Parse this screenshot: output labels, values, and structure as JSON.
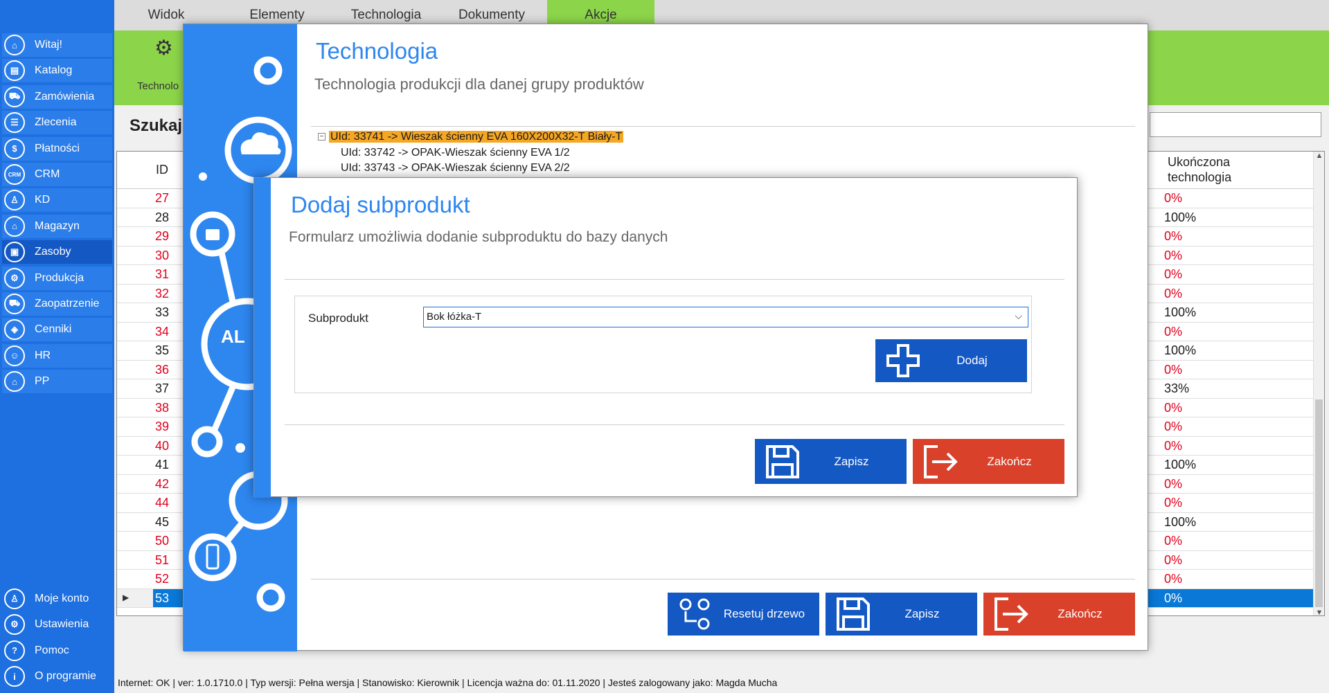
{
  "sidebar": {
    "items": [
      {
        "label": "Witaj!",
        "icon": "home-icon",
        "glyph": "⌂"
      },
      {
        "label": "Katalog",
        "icon": "book-icon",
        "glyph": "▤"
      },
      {
        "label": "Zamówienia",
        "icon": "cart-icon",
        "glyph": "⛟"
      },
      {
        "label": "Zlecenia",
        "icon": "list-icon",
        "glyph": "☰"
      },
      {
        "label": "Płatności",
        "icon": "dollar-icon",
        "glyph": "$"
      },
      {
        "label": "CRM",
        "icon": "crm-icon",
        "glyph": "CRM"
      },
      {
        "label": "KD",
        "icon": "user-icon",
        "glyph": "♙"
      },
      {
        "label": "Magazyn",
        "icon": "warehouse-icon",
        "glyph": "⌂"
      },
      {
        "label": "Zasoby",
        "icon": "box-icon",
        "glyph": "▣"
      },
      {
        "label": "Produkcja",
        "icon": "production-icon",
        "glyph": "⚙"
      },
      {
        "label": "Zaopatrzenie",
        "icon": "truck-icon",
        "glyph": "⛟"
      },
      {
        "label": "Cenniki",
        "icon": "tag-icon",
        "glyph": "◈"
      },
      {
        "label": "HR",
        "icon": "hr-icon",
        "glyph": "☺"
      },
      {
        "label": "PP",
        "icon": "factory-icon",
        "glyph": "⌂"
      }
    ],
    "bottom_items": [
      {
        "label": "Moje konto",
        "icon": "account-icon",
        "glyph": "♙"
      },
      {
        "label": "Ustawienia",
        "icon": "settings-icon",
        "glyph": "⚙"
      },
      {
        "label": "Pomoc",
        "icon": "help-icon",
        "glyph": "?"
      },
      {
        "label": "O programie",
        "icon": "info-icon",
        "glyph": "i"
      }
    ],
    "active_item": "Zasoby"
  },
  "topmenu": {
    "tabs": [
      "Widok",
      "Elementy",
      "Technologia",
      "Dokumenty",
      "Akcje"
    ],
    "active_tab": "Akcje"
  },
  "ribbon": {
    "label": "Technolo"
  },
  "search": {
    "label": "Szukaj:"
  },
  "grid": {
    "id_header": "ID",
    "tech_header_line1": "Ukończona",
    "tech_header_line2": "technologia",
    "rows": [
      {
        "id": "27",
        "pct": "0%",
        "red": true
      },
      {
        "id": "28",
        "pct": "100%",
        "red": false
      },
      {
        "id": "29",
        "pct": "0%",
        "red": true
      },
      {
        "id": "30",
        "pct": "0%",
        "red": true
      },
      {
        "id": "31",
        "pct": "0%",
        "red": true
      },
      {
        "id": "32",
        "pct": "0%",
        "red": true
      },
      {
        "id": "33",
        "pct": "100%",
        "red": false
      },
      {
        "id": "34",
        "pct": "0%",
        "red": true
      },
      {
        "id": "35",
        "pct": "100%",
        "red": false
      },
      {
        "id": "36",
        "pct": "0%",
        "red": true
      },
      {
        "id": "37",
        "pct": "33%",
        "red": false
      },
      {
        "id": "38",
        "pct": "0%",
        "red": true
      },
      {
        "id": "39",
        "pct": "0%",
        "red": true
      },
      {
        "id": "40",
        "pct": "0%",
        "red": true
      },
      {
        "id": "41",
        "pct": "100%",
        "red": false
      },
      {
        "id": "42",
        "pct": "0%",
        "red": true
      },
      {
        "id": "44",
        "pct": "0%",
        "red": true
      },
      {
        "id": "45",
        "pct": "100%",
        "red": false
      },
      {
        "id": "50",
        "pct": "0%",
        "red": true
      },
      {
        "id": "51",
        "pct": "0%",
        "red": true
      },
      {
        "id": "52",
        "pct": "0%",
        "red": true
      },
      {
        "id": "53",
        "pct": "0%",
        "red": false,
        "selected": true
      }
    ]
  },
  "statusbar": {
    "text": "Internet: OK  |   ver: 1.0.1710.0   |   Typ wersji: Pełna wersja   |   Stanowisko: Kierownik   |   Licencja ważna do: 01.11.2020   |   Jesteś zalogowany jako: Magda Mucha"
  },
  "technologia_dialog": {
    "title": "Technologia",
    "subtitle": "Technologia produkcji dla danej grupy produktów",
    "tree": {
      "toggle": "−",
      "root": "UId: 33741 -> Wieszak ścienny EVA 160X200X32-T Biały-T",
      "children": [
        "UId: 33742 -> OPAK-Wieszak ścienny EVA   1/2",
        "UId: 33743 -> OPAK-Wieszak ścienny EVA   2/2"
      ]
    },
    "buttons": {
      "reset": "Resetuj drzewo",
      "save": "Zapisz",
      "close": "Zakończ"
    }
  },
  "subprodukt_dialog": {
    "title": "Dodaj subprodukt",
    "subtitle": "Formularz umożliwia dodanie subproduktu do bazy danych",
    "field_label": "Subprodukt",
    "selected_value": "Bok łóżka-T",
    "add_button": "Dodaj",
    "save_button": "Zapisz",
    "close_button": "Zakończ"
  },
  "colors": {
    "sidebar": "#1e6fe0",
    "accent_green": "#8cd54a",
    "dialog_blue": "#2e86ef",
    "button_blue": "#1458c4",
    "button_red": "#d9412a",
    "highlight_orange": "#f5a623",
    "zero_red": "#e0001b"
  }
}
